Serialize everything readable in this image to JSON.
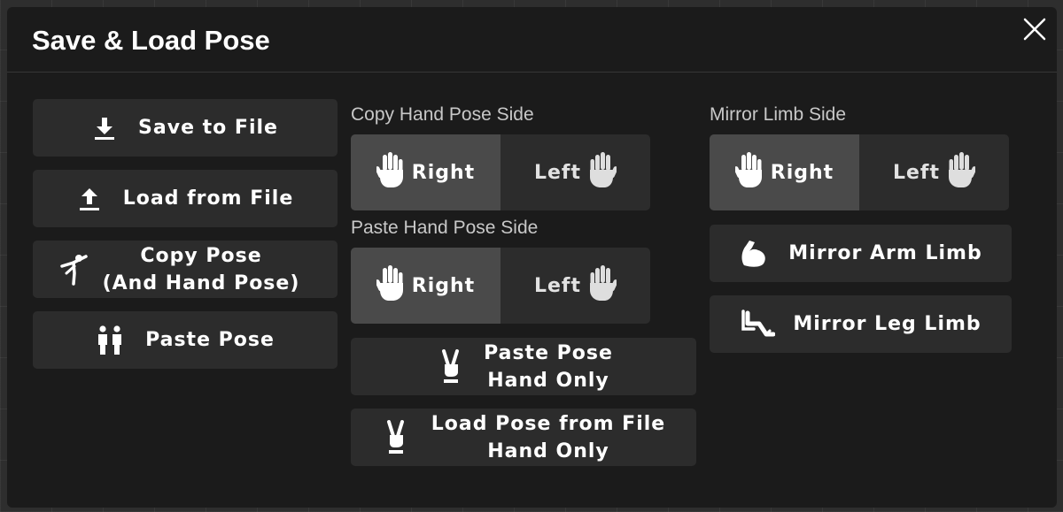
{
  "dialog": {
    "title": "Save & Load Pose",
    "close_icon": "close-icon"
  },
  "left_column": {
    "save_to_file": "Save to File",
    "load_from_file": "Load from File",
    "copy_pose": "Copy Pose\n(And Hand Pose)",
    "paste_pose": "Paste Pose"
  },
  "middle_column": {
    "copy_hand_label": "Copy Hand Pose Side",
    "copy_hand_right": "Right",
    "copy_hand_left": "Left",
    "paste_hand_label": "Paste Hand Pose Side",
    "paste_hand_right": "Right",
    "paste_hand_left": "Left",
    "paste_pose_hand_only": "Paste Pose\nHand Only",
    "load_pose_hand_only": "Load Pose from File\nHand Only"
  },
  "right_column": {
    "mirror_limb_label": "Mirror Limb Side",
    "mirror_right": "Right",
    "mirror_left": "Left",
    "mirror_arm": "Mirror Arm Limb",
    "mirror_leg": "Mirror Leg Limb"
  },
  "selected": {
    "copy_hand_side": "Right",
    "paste_hand_side": "Right",
    "mirror_limb_side": "Right"
  },
  "colors": {
    "dialog_bg": "#1b1b1b",
    "button_bg": "#2c2c2c",
    "active_bg": "#4a4a4a",
    "label": "#c8c8c8"
  }
}
